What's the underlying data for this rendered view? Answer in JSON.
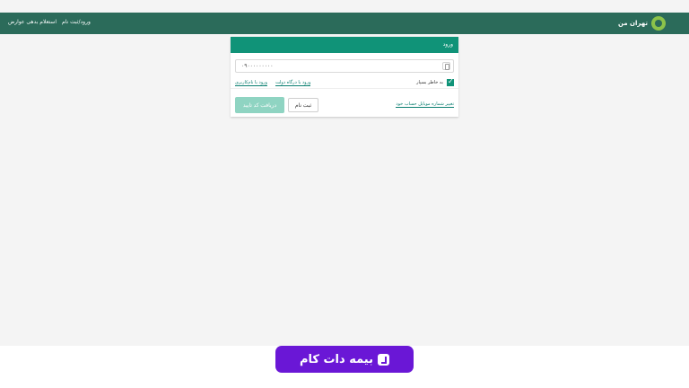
{
  "nav": {
    "logo": "تهران من",
    "login_register": "ورود/ثبت نام",
    "fines_inquiry": "استعلام بدهی عوارض"
  },
  "card": {
    "title": "ورود",
    "mobile_value": "۰۹۰۰۰۰۰۰۰۰۰",
    "gov_gateway_link": "ورود با درگاه دولت",
    "password_link": "ورود با نام‌کاربری",
    "remember_label": "به خاطر بسپار",
    "change_mobile_link": "تغییر شماره موبایل حساب خود",
    "send_code_button": "دریافت کد تایید",
    "register_button": "ثبت نام"
  },
  "banner": {
    "text": "بیمه دات کام"
  },
  "colors": {
    "topbar": "#2b6b5a",
    "accent": "#109378",
    "banner": "#6a17d6"
  }
}
